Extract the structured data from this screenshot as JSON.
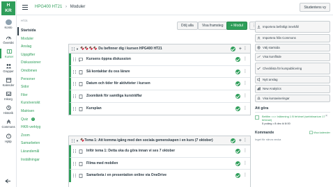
{
  "logo": {
    "line1": "H",
    "line2": "KR"
  },
  "global_nav": [
    {
      "label": "Konto",
      "icon": "avatar-icon"
    },
    {
      "label": "Översikt",
      "icon": "dashboard-icon"
    },
    {
      "label": "Kurser",
      "icon": "courses-icon"
    },
    {
      "label": "Grupper",
      "icon": "groups-icon"
    },
    {
      "label": "Kalender",
      "icon": "calendar-icon"
    },
    {
      "label": "Inkorg",
      "icon": "inbox-icon"
    },
    {
      "label": "Historik",
      "icon": "history-icon"
    },
    {
      "label": "Commons",
      "icon": "commons-icon"
    },
    {
      "label": "Hjälp",
      "icon": "help-icon"
    }
  ],
  "header": {
    "course": "HPG400 HT21",
    "separator": "›",
    "page": "Moduler",
    "student_view": "Studentens vy"
  },
  "course_nav": {
    "term": "HT21",
    "items": [
      "Startsida",
      "Moduler",
      "Anslag",
      "Uppgifter",
      "Diskussioner",
      "Omdömen",
      "Personer",
      "Sidor",
      "Filer",
      "Kursöversikt",
      "Matrisen",
      "Quiz",
      "HKR-verktyg",
      "Zoom",
      "Samarbeten",
      "Lärandemål",
      "Inställningar"
    ],
    "selected": "Startsida",
    "quiz_badge": "1"
  },
  "toolbar": {
    "collapse_all": "Dölj alla",
    "view_progress": "Visa framsteg",
    "add_module": "+ Modul",
    "more": "⋮"
  },
  "modules": [
    {
      "title": "🍫🍫🍫🍫 Du befinner dig i kursen HPG400 HT21",
      "items": [
        "Kursens öppna diskussion",
        "Så kontaktar du oss lärare",
        "Datum och tider för aktiviteter i kursen",
        "Zoomlänk för samtliga kursträffar",
        "Kursplan"
      ]
    },
    {
      "title": "🍫Tema 1: Att komma igång med den sociala gemenskapen i en kurs (7 oktober)",
      "items": [
        "Inför tema 1: Detta ska du göra innan vi ses 7 oktober",
        "Filma med mobilen",
        "Samarbeta i en presentation online via OneDrive"
      ]
    }
  ],
  "sidebar": {
    "buttons": [
      "Importera befintligt innehåll",
      "Importera från Commons",
      "Välj startsida",
      "Visa kursflöde",
      "Checklista för kurspublicering",
      "Nytt anslag",
      "New Analytics",
      "Visa kursaviseringar"
    ],
    "todo_heading": "Att göra",
    "todo_item_title": "Betitlm ==> Inlämning 1 B fehlmel (webbinarium 17 fehlmel)",
    "todo_item_meta": "5 poäng • 8 dec kl 8:00",
    "todo_dismiss": "×",
    "upcoming_heading": "Kommande",
    "upcoming_link": "Visa kalender",
    "upcoming_none": "Inget för närva vecka"
  },
  "colors": {
    "accent": "#2f9e5a",
    "text": "#2d3b45"
  }
}
